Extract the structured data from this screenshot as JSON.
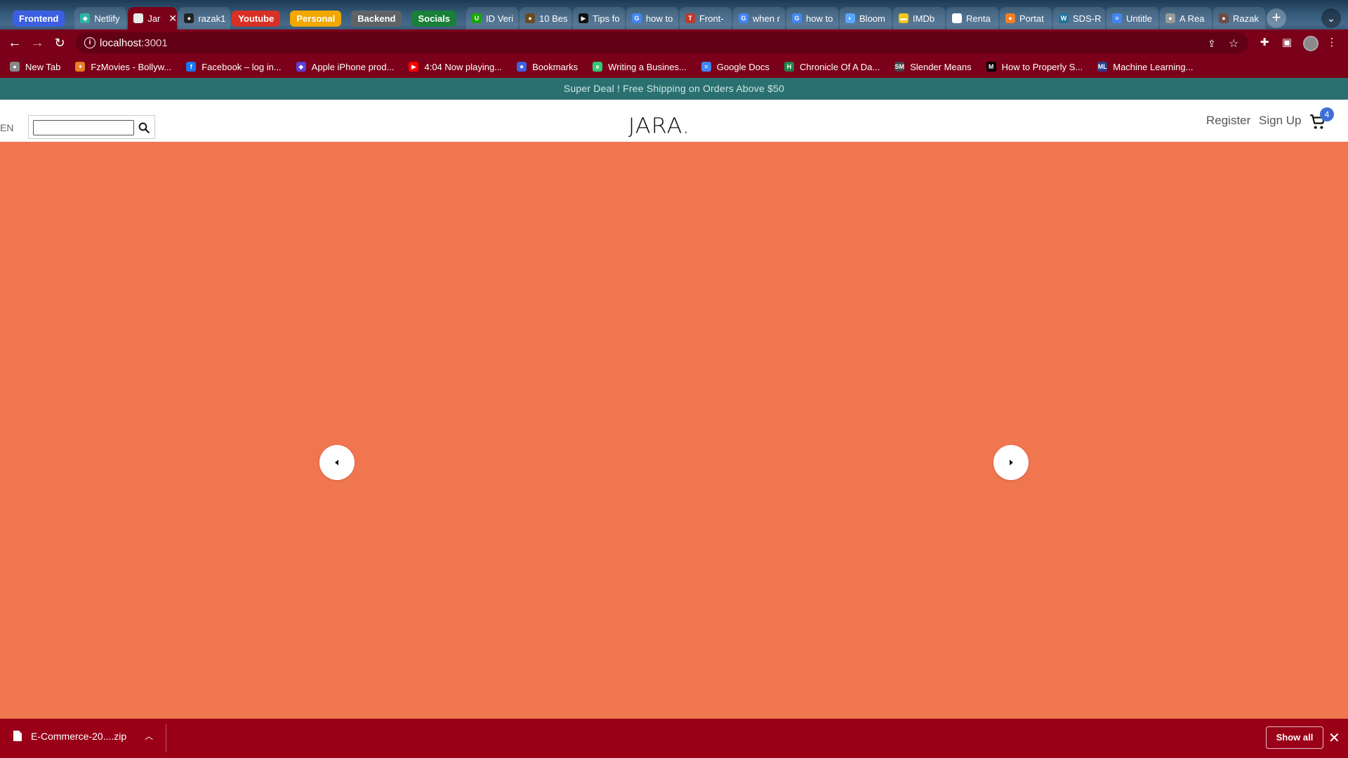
{
  "browser": {
    "tabs": [
      {
        "type": "group",
        "label": "Frontend",
        "color": "#3b5fe0"
      },
      {
        "type": "tab",
        "label": "Netlify",
        "fav_color": "#2fb5a3",
        "fav": "◆"
      },
      {
        "type": "tab",
        "label": "Jar",
        "fav_color": "#e9e9e9",
        "fav": "",
        "active": true
      },
      {
        "type": "tab",
        "label": "razak1",
        "fav_color": "#222",
        "fav": "●"
      },
      {
        "type": "group",
        "label": "Youtube",
        "color": "#d93025"
      },
      {
        "type": "group",
        "label": "Personal",
        "color": "#f2a800"
      },
      {
        "type": "group",
        "label": "Backend",
        "color": "#5f6368"
      },
      {
        "type": "group",
        "label": "Socials",
        "color": "#188038"
      },
      {
        "type": "tab",
        "label": "ID Veri",
        "fav_color": "#14a800",
        "fav": "U"
      },
      {
        "type": "tab",
        "label": "10 Bes",
        "fav_color": "#6b4a1e",
        "fav": "●"
      },
      {
        "type": "tab",
        "label": "Tips fo",
        "fav_color": "#111",
        "fav": "▶"
      },
      {
        "type": "tab",
        "label": "how to",
        "fav_color": "#4285f4",
        "fav": "G"
      },
      {
        "type": "tab",
        "label": "Front-",
        "fav_color": "#c0392b",
        "fav": "T"
      },
      {
        "type": "tab",
        "label": "when r",
        "fav_color": "#4285f4",
        "fav": "G"
      },
      {
        "type": "tab",
        "label": "how to",
        "fav_color": "#4285f4",
        "fav": "G"
      },
      {
        "type": "tab",
        "label": "Bloom",
        "fav_color": "#58a6ff",
        "fav": "◐"
      },
      {
        "type": "tab",
        "label": "IMDb",
        "fav_color": "#f5c518",
        "fav": "▬"
      },
      {
        "type": "tab",
        "label": "Renta",
        "fav_color": "#fff",
        "fav": "P"
      },
      {
        "type": "tab",
        "label": "Portat",
        "fav_color": "#f47f24",
        "fav": "●"
      },
      {
        "type": "tab",
        "label": "SDS-R",
        "fav_color": "#21759b",
        "fav": "W"
      },
      {
        "type": "tab",
        "label": "Untitle",
        "fav_color": "#4285f4",
        "fav": "≡"
      },
      {
        "type": "tab",
        "label": "A Rea",
        "fav_color": "#999",
        "fav": "●"
      },
      {
        "type": "tab",
        "label": "Razak",
        "fav_color": "#6d4c41",
        "fav": "●"
      }
    ],
    "url_host": "localhost",
    "url_port": ":3001",
    "bookmarks": [
      {
        "label": "New Tab",
        "fav_color": "#888",
        "fav": "●"
      },
      {
        "label": "FzMovies - Bollyw...",
        "fav_color": "#e67e22",
        "fav": "✶"
      },
      {
        "label": "Facebook – log in...",
        "fav_color": "#1877f2",
        "fav": "f"
      },
      {
        "label": "Apple iPhone prod...",
        "fav_color": "#5b3fd6",
        "fav": "◆"
      },
      {
        "label": "4:04 Now playing...",
        "fav_color": "#ff0000",
        "fav": "▶"
      },
      {
        "label": "Bookmarks",
        "fav_color": "#3b5fe0",
        "fav": "★"
      },
      {
        "label": "Writing a Busines...",
        "fav_color": "#2ecc71",
        "fav": "e"
      },
      {
        "label": "Google Docs",
        "fav_color": "#4285f4",
        "fav": "≡"
      },
      {
        "label": "Chronicle Of A Da...",
        "fav_color": "#1e8449",
        "fav": "H"
      },
      {
        "label": "Slender Means",
        "fav_color": "#444",
        "fav": "SM"
      },
      {
        "label": "How to Properly S...",
        "fav_color": "#000",
        "fav": "M"
      },
      {
        "label": "Machine Learning...",
        "fav_color": "#2c3e8f",
        "fav": "ML"
      }
    ]
  },
  "site": {
    "promo_text": "Super Deal ! Free Shipping on Orders Above $50",
    "lang": "EN",
    "search_value": "",
    "brand": "JARA.",
    "register_label": "Register",
    "signup_label": "Sign Up",
    "cart_count": "4"
  },
  "downloads": {
    "file_name": "E-Commerce-20....zip",
    "show_all_label": "Show all"
  }
}
